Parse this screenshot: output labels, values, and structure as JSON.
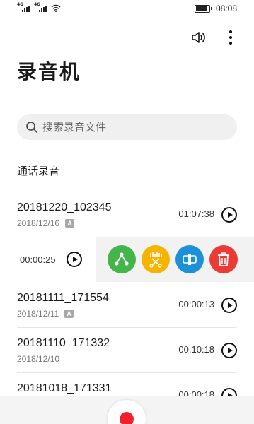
{
  "status_bar": {
    "signal_1_tag": "4G",
    "signal_2_tag": "4G",
    "battery_level": 0.9,
    "time": "08:08"
  },
  "header": {
    "title": "录音机"
  },
  "search": {
    "placeholder": "搜索录音文件"
  },
  "section": {
    "title": "通话录音"
  },
  "recordings": [
    {
      "name": "20181220_102345",
      "date": "2018/12/16",
      "badge": "A",
      "duration": "01:07:38"
    },
    {
      "duration": "00:00:25"
    },
    {
      "name": "20181111_171554",
      "date": "2018/12/11",
      "badge": "A",
      "duration": "00:00:13"
    },
    {
      "name": "20181110_171332",
      "date": "2018/12/10",
      "duration": "00:10:18"
    },
    {
      "name": "20181018_171331",
      "duration": "00:00:18"
    }
  ],
  "colors": {
    "share": "#44b54a",
    "clip": "#f6b400",
    "rename": "#1e90d8",
    "delete": "#ea3b36",
    "record": "#f0202e"
  },
  "icons": {
    "speaker": "speaker-icon",
    "more": "more-vertical-icon",
    "search": "search-icon",
    "play": "play-icon",
    "share": "share-icon",
    "clip": "clip-icon",
    "rename": "rename-icon",
    "delete": "delete-icon",
    "record": "record-icon"
  }
}
